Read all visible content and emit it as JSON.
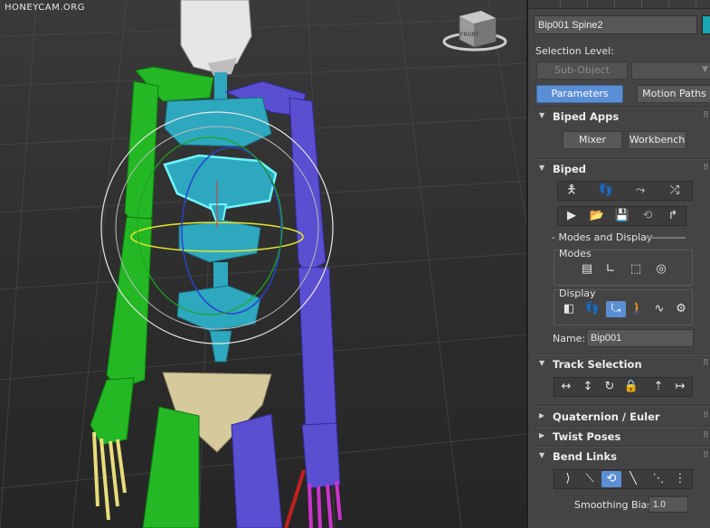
{
  "watermark": "HONEYCAM.ORG",
  "viewcube": {
    "face_label": "FRONT"
  },
  "panel": {
    "object_name": "Bip001 Spine2",
    "object_color": "#18a7b4",
    "selection_level_label": "Selection Level:",
    "sub_object_label": "Sub-Object",
    "parameters_label": "Parameters",
    "motion_paths_label": "Motion Paths",
    "biped_apps": {
      "title": "Biped Apps",
      "mixer_label": "Mixer",
      "workbench_label": "Workbench"
    },
    "biped": {
      "title": "Biped",
      "row1_icons": [
        "figure-mode-icon",
        "footstep-mode-icon",
        "motion-flow-icon",
        "mixer-mode-icon"
      ],
      "row2_icons": [
        "biped-playback-icon",
        "load-file-icon",
        "save-file-icon",
        "convert-icon",
        "move-all-mode-icon"
      ],
      "modes_and_display_label": "- Modes and Display",
      "modes_label": "Modes",
      "modes_icons": [
        "buffer-mode-icon",
        "rubber-band-mode-icon",
        "scale-stride-icon",
        "in-place-mode-icon"
      ],
      "display_label": "Display",
      "display_icons": [
        "objects-display-icon",
        "show-footsteps-icon",
        "twist-links-icon",
        "leg-states-icon",
        "trajectories-icon",
        "preferences-icon"
      ],
      "name_label": "Name:",
      "name_value": "Bip001"
    },
    "track_selection": {
      "title": "Track Selection",
      "icons": [
        "symmetrical-icon",
        "opposite-icon",
        "body-rotation-icon",
        "lock-cob-icon",
        "select-parent-icon",
        "select-child-icon"
      ]
    },
    "quaternion_euler": {
      "title": "Quaternion / Euler"
    },
    "twist_poses": {
      "title": "Twist Poses"
    },
    "bend_links": {
      "title": "Bend Links",
      "icons": [
        "bend-links-mode-icon",
        "twist-links-mode-icon",
        "twist-individual-mode-icon",
        "smoothing-mode-icon",
        "zero-twist-icon",
        "set-parent-icon"
      ],
      "smoothing_bias_label": "Smoothing Bias:",
      "smoothing_bias_value": "1.0"
    }
  },
  "colors": {
    "spine_cyan": "#2ea8bf",
    "left_arm_green": "#24b824",
    "right_arm_purple": "#5a4fd0",
    "pelvis_tan": "#d6c99b",
    "head_white": "#e6e6e6",
    "selected_outline": "#6ff6ff",
    "accent_blue": "#5b8fd5"
  }
}
